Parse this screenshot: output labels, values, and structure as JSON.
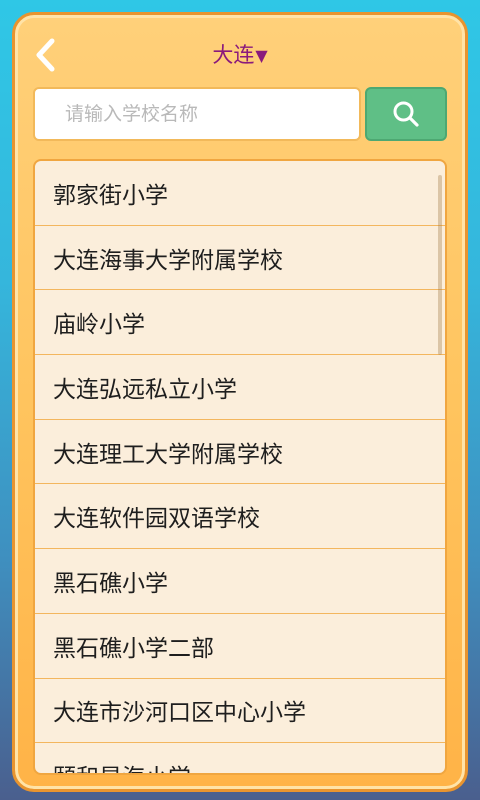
{
  "header": {
    "title": "大连",
    "title_arrow": "▼"
  },
  "search": {
    "placeholder": "请输入学校名称",
    "value": ""
  },
  "schools": [
    "郭家街小学",
    "大连海事大学附属学校",
    "庙岭小学",
    "大连弘远私立小学",
    "大连理工大学附属学校",
    "大连软件园双语学校",
    "黑石礁小学",
    "黑石礁小学二部",
    "大连市沙河口区中心小学",
    "颐和星海小学"
  ],
  "colors": {
    "panel_bg": "#ffc45e",
    "title": "#8a1a7c",
    "search_button": "#5fbf86",
    "list_bg": "#fbeedb"
  }
}
